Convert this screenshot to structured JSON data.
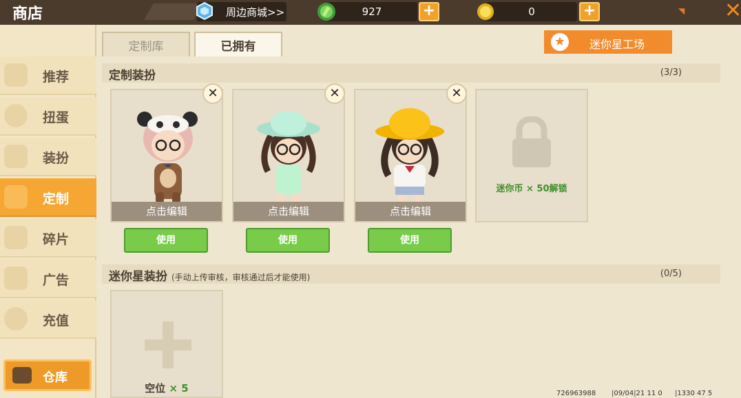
{
  "header": {
    "title": "商店",
    "merch_label": "周边商城>>",
    "gems": "927",
    "coins": "0"
  },
  "sidebar": {
    "items": [
      {
        "label": "推荐",
        "icon": "thumb-up-icon"
      },
      {
        "label": "扭蛋",
        "icon": "capsule-icon"
      },
      {
        "label": "装扮",
        "icon": "outfit-icon"
      },
      {
        "label": "定制",
        "icon": "pencil-icon"
      },
      {
        "label": "碎片",
        "icon": "puzzle-icon"
      },
      {
        "label": "广告",
        "icon": "gift-icon"
      },
      {
        "label": "充值",
        "icon": "coins-icon"
      }
    ],
    "active_index": 3,
    "warehouse_label": "仓库"
  },
  "tabs": [
    {
      "label": "定制库",
      "active": false
    },
    {
      "label": "已拥有",
      "active": true
    }
  ],
  "mini_factory_label": "迷你星工场",
  "custom_section": {
    "title": "定制装扮",
    "count": "(3/3)",
    "cards": [
      {
        "character": "panda-hood-girl",
        "edit_label": "点击编辑",
        "use_label": "使用"
      },
      {
        "character": "mint-hat-girl",
        "edit_label": "点击编辑",
        "use_label": "使用"
      },
      {
        "character": "yellow-hat-girl",
        "edit_label": "点击编辑",
        "use_label": "使用"
      }
    ],
    "locked_label": "迷你币 × 50解锁"
  },
  "mini_section": {
    "title": "迷你星装扮",
    "subtitle": "(手动上传审核，审核通过后才能使用)",
    "count": "(0/5)",
    "empty_label": "空位",
    "empty_count": "× 5"
  },
  "footer": {
    "id": "726963988",
    "date": "|09/04|21 11 0",
    "version": "|1330 47 5"
  },
  "colors": {
    "accent_orange": "#f6a733",
    "use_green": "#79cc4a",
    "topbar_brown": "#4b3b2c"
  }
}
